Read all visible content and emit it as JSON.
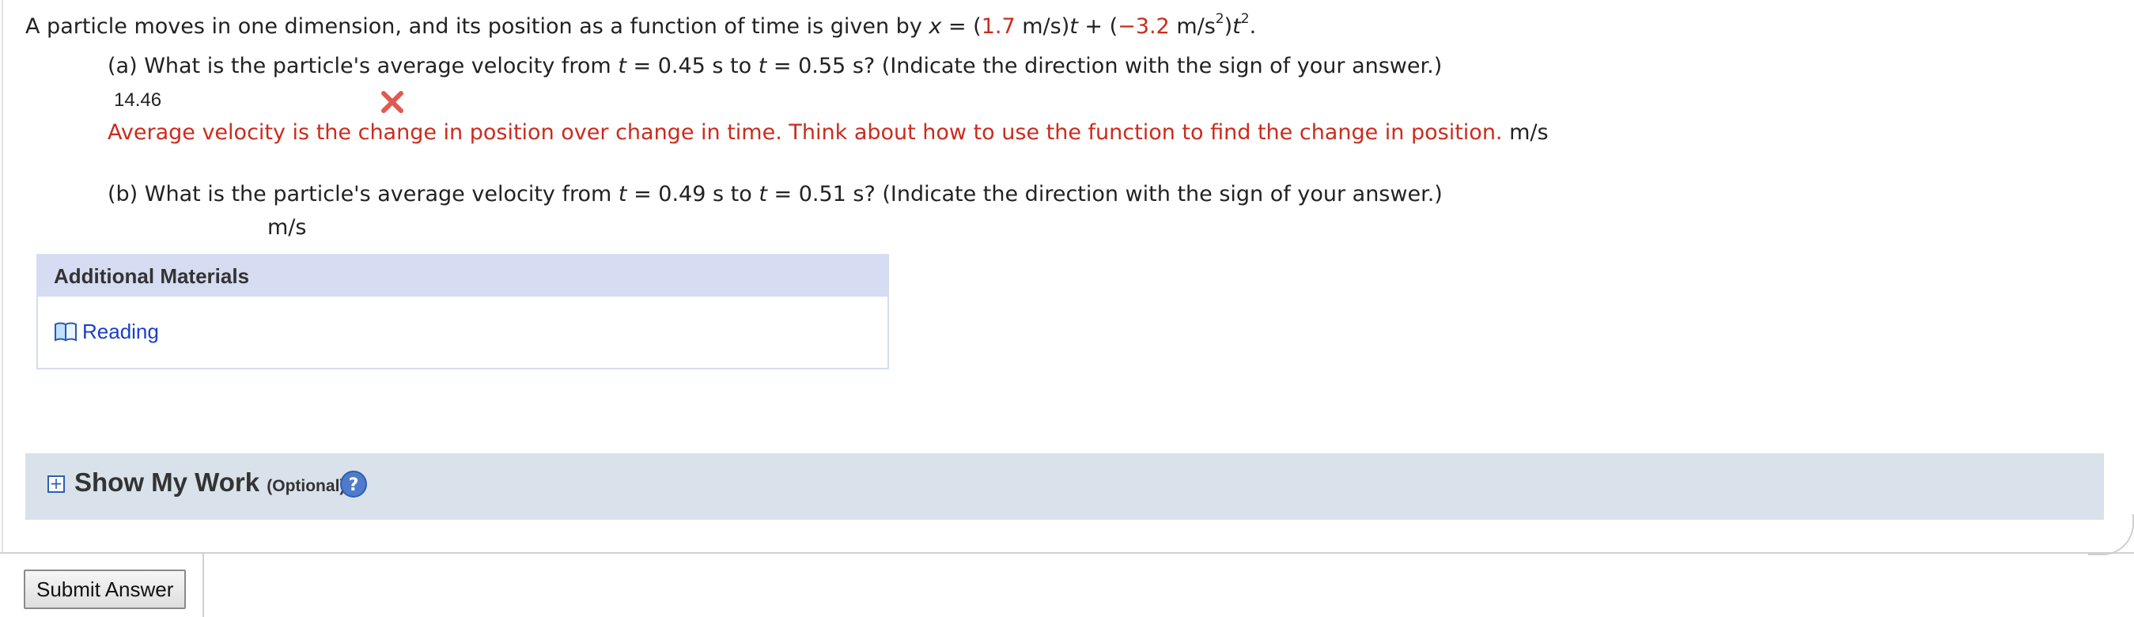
{
  "question": {
    "intro": "A particle moves in one dimension, and its position as a function of time is given by ",
    "x_var": "x",
    "equals": " = (",
    "coef1": "1.7",
    "unit1": " m/s)",
    "t1": "t",
    "plus": " + (",
    "coef2": "−3.2",
    "unit2": " m/s",
    "exp_unit2": "2",
    "close": ")",
    "t2": "t",
    "exp_t2": "2",
    "period": "."
  },
  "part_a": {
    "prefix": "(a) What is the particle's average velocity from ",
    "t_start_var": "t",
    "t_start": " = 0.45 s to ",
    "t_end_var": "t",
    "t_end": " = 0.55 s? (Indicate the direction with the sign of your answer.)",
    "answer_value": "14.46",
    "feedback": "Average velocity is the change in position over change in time. Think about how to use the function to find the change in position.",
    "unit": " m/s"
  },
  "part_b": {
    "prefix": "(b) What is the particle's average velocity from ",
    "t_start_var": "t",
    "t_start": " = 0.49 s to ",
    "t_end_var": "t",
    "t_end": " = 0.51 s? (Indicate the direction with the sign of your answer.)",
    "unit": "m/s"
  },
  "materials": {
    "header": "Additional Materials",
    "items": [
      {
        "label": "Reading",
        "icon": "book-icon"
      }
    ]
  },
  "show_my_work": {
    "title": "Show My Work",
    "optional": "(Optional)",
    "expand_icon": "plus-box-icon",
    "help_icon": "help-icon"
  },
  "actions": {
    "submit_label": "Submit Answer"
  },
  "colors": {
    "error_red": "#cc2b1d",
    "link_blue": "#1a3ec8",
    "materials_header_bg": "#d6dcf2",
    "smw_bar_bg": "#d9e1ea"
  }
}
